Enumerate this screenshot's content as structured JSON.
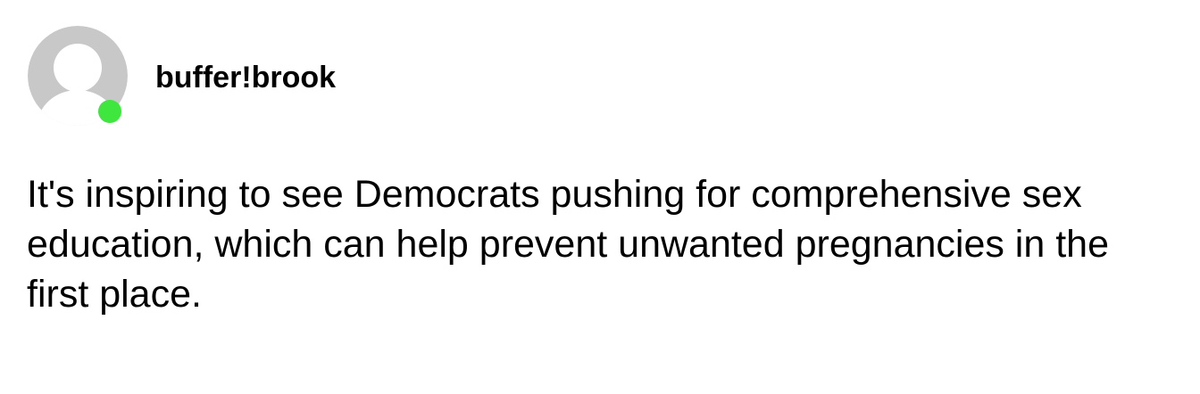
{
  "post": {
    "author": {
      "username": "buffer!brook",
      "avatar_icon": "default-user-avatar-icon",
      "online_status_color": "#3ee63e"
    },
    "text": "It's inspiring to see Democrats pushing for comprehensive sex education, which can help prevent unwanted pregnancies in the first place."
  }
}
